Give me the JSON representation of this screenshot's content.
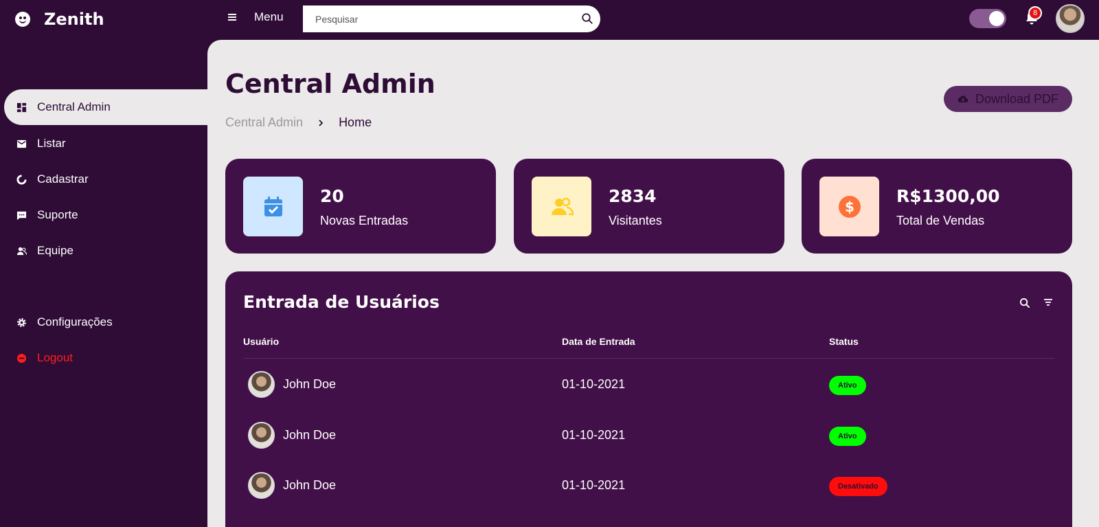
{
  "app": {
    "name": "Zenith"
  },
  "topbar": {
    "menu_label": "Menu",
    "search": {
      "placeholder": "Pesquisar",
      "value": ""
    },
    "dark_mode_on": true,
    "notifications_count": "8"
  },
  "sidebar": {
    "items": [
      {
        "label": "Central Admin",
        "icon": "dashboard-icon",
        "active": true
      },
      {
        "label": "Listar",
        "icon": "mail-icon"
      },
      {
        "label": "Cadastrar",
        "icon": "chart-pie-icon"
      },
      {
        "label": "Suporte",
        "icon": "chat-icon"
      },
      {
        "label": "Equipe",
        "icon": "team-icon"
      }
    ],
    "settings_label": "Configurações",
    "logout_label": "Logout"
  },
  "page": {
    "title": "Central Admin",
    "breadcrumb": {
      "parent": "Central Admin",
      "current": "Home"
    },
    "download_label": "Download PDF"
  },
  "cards": [
    {
      "value": "20",
      "label": "Novas Entradas",
      "icon": "calendar-check-icon",
      "icon_bg": "#cfe8ff",
      "icon_color": "#3c91e6"
    },
    {
      "value": "2834",
      "label": "Visitantes",
      "icon": "people-icon",
      "icon_bg": "#fff2c6",
      "icon_color": "#ffce26"
    },
    {
      "value": "R$1300,00",
      "label": "Total de Vendas",
      "icon": "dollar-circle-icon",
      "icon_bg": "#ffe0d3",
      "icon_color": "#fd7238"
    }
  ],
  "table": {
    "title": "Entrada de Usuários",
    "columns": [
      "Usuário",
      "Data de Entrada",
      "Status"
    ],
    "rows": [
      {
        "user": "John Doe",
        "date": "01-10-2021",
        "status": "Ativo"
      },
      {
        "user": "John Doe",
        "date": "01-10-2021",
        "status": "Ativo"
      },
      {
        "user": "John Doe",
        "date": "01-10-2021",
        "status": "Desativado"
      }
    ]
  },
  "colors": {
    "background": "#2e0c36",
    "panel": "#421048",
    "content_bg": "#ebe9ea",
    "status_active": "#00ff00",
    "status_inactive": "#ff0c0c",
    "logout": "#ff1d1d"
  }
}
